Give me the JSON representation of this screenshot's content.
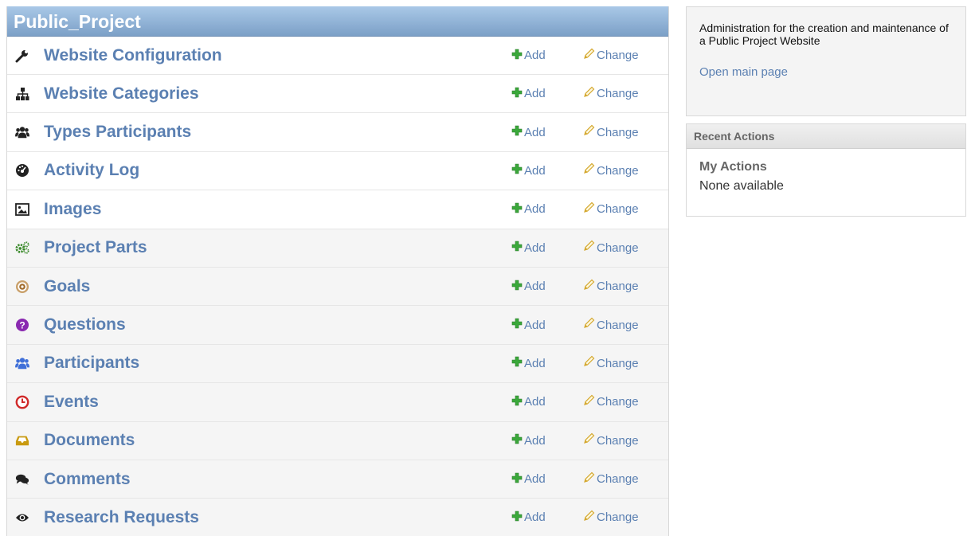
{
  "module": {
    "caption": "Public_Project",
    "add_label": "Add",
    "change_label": "Change",
    "rows": [
      {
        "label": "Website Configuration",
        "icon": "wrench-icon",
        "color": "#222222"
      },
      {
        "label": "Website Categories",
        "icon": "sitemap-icon",
        "color": "#222222"
      },
      {
        "label": "Types Participants",
        "icon": "group-icon",
        "color": "#222222"
      },
      {
        "label": "Activity Log",
        "icon": "dashboard-icon",
        "color": "#222222"
      },
      {
        "label": "Images",
        "icon": "picture-icon",
        "color": "#222222"
      },
      {
        "label": "Project Parts",
        "icon": "cogs-icon",
        "color": "#3a8a2a"
      },
      {
        "label": "Goals",
        "icon": "target-icon",
        "color": "#a06a2a"
      },
      {
        "label": "Questions",
        "icon": "question-icon",
        "color": "#8a2ab0"
      },
      {
        "label": "Participants",
        "icon": "group-icon",
        "color": "#3f6fd8"
      },
      {
        "label": "Events",
        "icon": "clock-icon",
        "color": "#d02a2a"
      },
      {
        "label": "Documents",
        "icon": "inbox-icon",
        "color": "#c99a10"
      },
      {
        "label": "Comments",
        "icon": "comments-icon",
        "color": "#222222"
      },
      {
        "label": "Research Requests",
        "icon": "eye-icon",
        "color": "#222222"
      }
    ]
  },
  "sidebar": {
    "description": "Administration for the creation and maintenance of a Public Project Website",
    "open_link": "Open main page",
    "recent": {
      "title": "Recent Actions",
      "subtitle": "My Actions",
      "empty": "None available"
    }
  },
  "colors": {
    "link": "#5b80b2",
    "caption_bg": "#7ca0c7",
    "add_icon": "#3aa83a",
    "change_icon": "#d4a830"
  }
}
